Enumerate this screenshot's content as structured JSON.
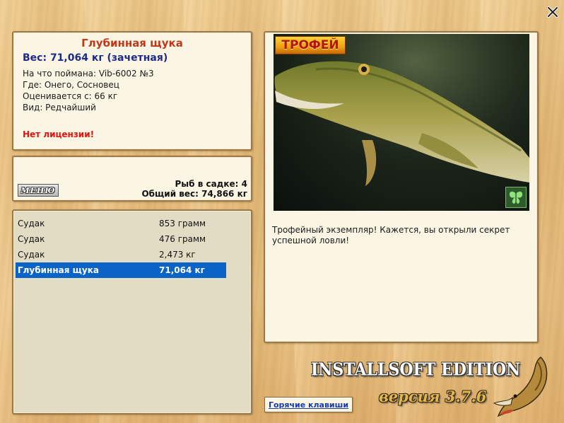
{
  "fish": {
    "name": "Глубинная щука",
    "weight": "Вес: 71,064 кг (зачетная)",
    "caught_on": "На что поймана: Vib-6002 №3",
    "where": "Где: Онего, Сосновец",
    "rated_from": "Оценивается с: 66 кг",
    "kind": "Вид: Редчайший",
    "license_warning": "Нет лицензии!"
  },
  "cage": {
    "menu_label": "МЕНЮ",
    "count": "Рыб в садке: 4",
    "total_weight": "Общий вес: 74,866 кг"
  },
  "catch_list": [
    {
      "name": "Судак",
      "weight": "853 грамм",
      "selected": false
    },
    {
      "name": "Судак",
      "weight": "476 грамм",
      "selected": false
    },
    {
      "name": "Судак",
      "weight": "2,473 кг",
      "selected": false
    },
    {
      "name": "Глубинная щука",
      "weight": "71,064 кг",
      "selected": true
    }
  ],
  "photo": {
    "badge": "ТРОФЕЙ",
    "description": "Трофейный экземпляр! Кажется, вы открыли секрет успешной ловли!"
  },
  "footer": {
    "brand": "INSTALLSOFT EDITION",
    "version": "версия 3.7.6",
    "hotkeys_label": "Горячие клавиши"
  },
  "colors": {
    "title": "#c0381a",
    "weight": "#1d2a8a",
    "warning": "#e3140f",
    "selection": "#0a64c8",
    "link": "#1a3aa8"
  }
}
